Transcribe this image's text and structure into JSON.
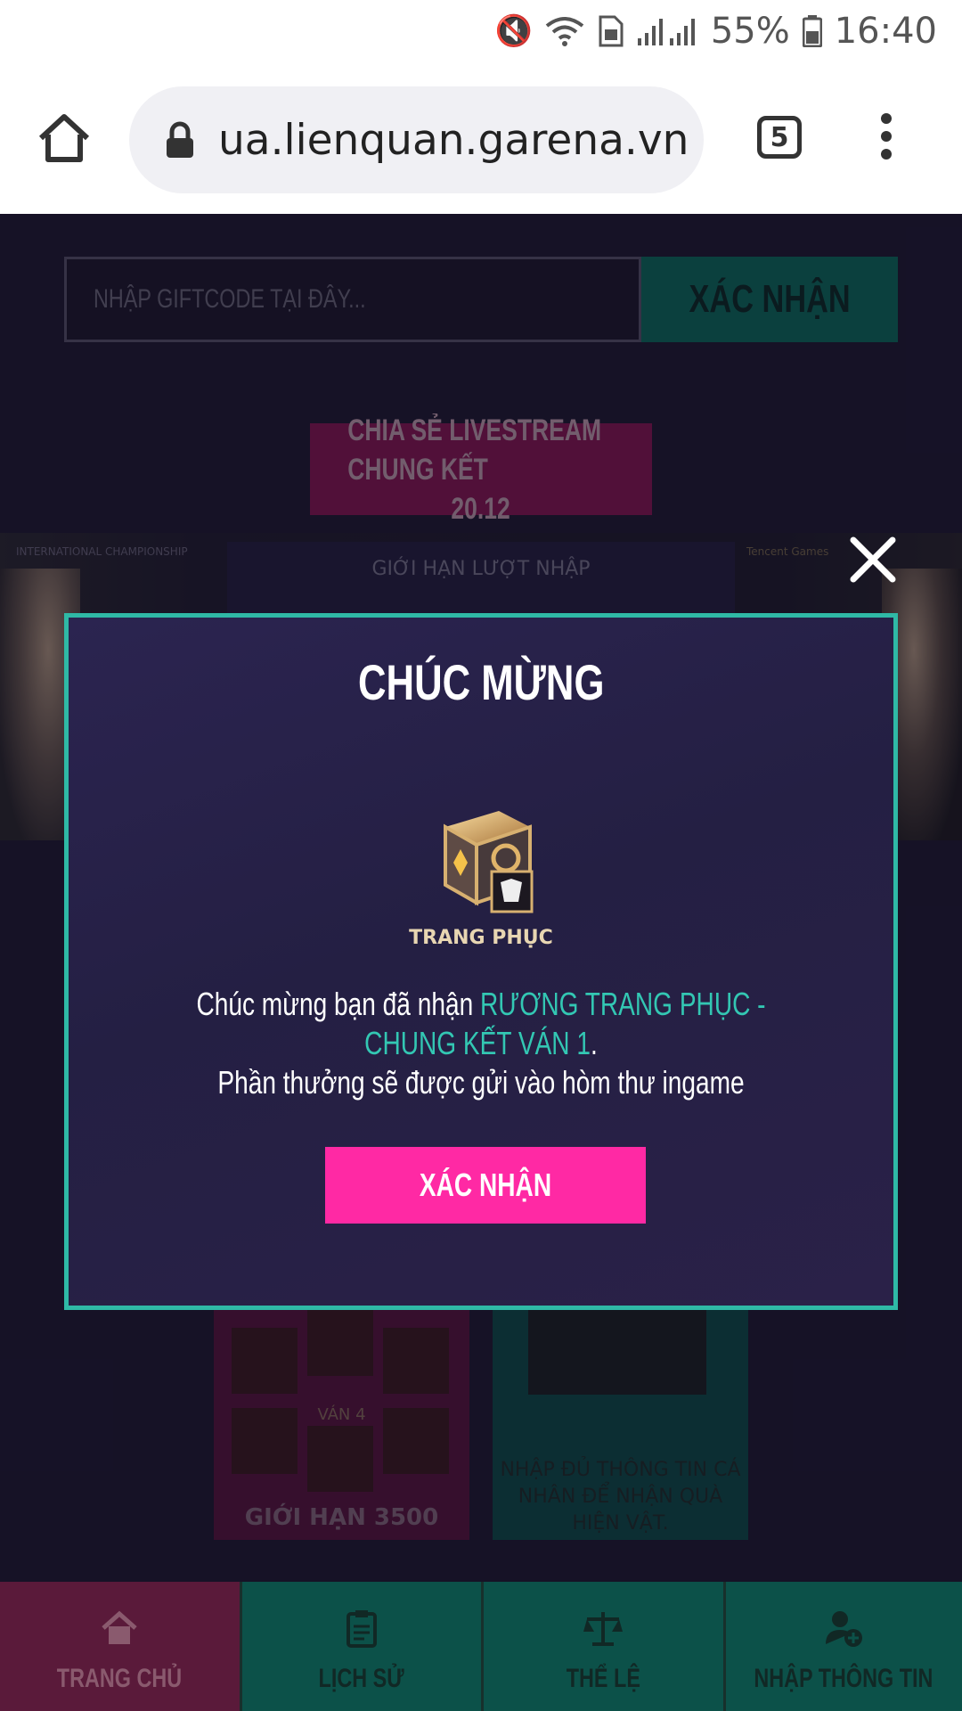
{
  "status_bar": {
    "battery": "55%",
    "time": "16:40"
  },
  "browser": {
    "url": "ua.lienquan.garena.vn",
    "tab_count": "5"
  },
  "page": {
    "giftcode_placeholder": "NHẬP GIFTCODE TẠI ĐÂY...",
    "giftcode_submit": "XÁC NHẬN",
    "livestream_line1": "CHIA SẺ LIVESTREAM CHUNG KẾT",
    "livestream_line2": "20.12",
    "banner_panel_title": "GIỚI HẠN LƯỢT NHẬP",
    "banner_logo_left": "INTERNATIONAL CHAMPIONSHIP",
    "banner_logo_right": "Tencent Games",
    "card_round": "VÁN 4",
    "card_limit": "GIỚI HẠN 3500",
    "card_info": "NHẬP ĐỦ THÔNG TIN CÁ NHÂN ĐỂ NHẬN QUÀ HIỆN VẬT."
  },
  "modal": {
    "title": "CHÚC MỪNG",
    "chest_caption": "TRANG PHỤC",
    "msg_prefix": "Chúc mừng bạn đã nhận ",
    "msg_reward": "RƯƠNG TRANG PHỤC - CHUNG KẾT VÁN 1",
    "msg_suffix": ".",
    "msg_line2": "Phần thưởng sẽ được gửi vào hòm thư ingame",
    "confirm": "XÁC NHẬN"
  },
  "nav": {
    "home": "TRANG CHỦ",
    "history": "LỊCH SỬ",
    "rules": "THỂ LỆ",
    "info": "NHẬP THÔNG TIN"
  }
}
